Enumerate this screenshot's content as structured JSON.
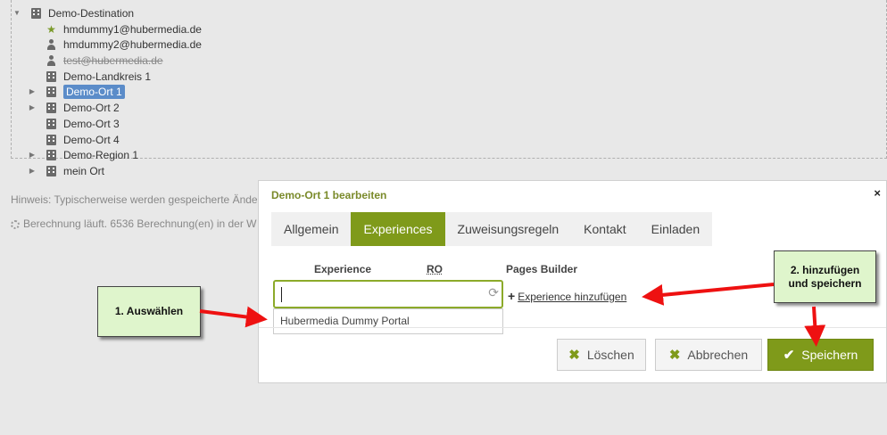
{
  "tree": [
    {
      "label": "Demo-Destination",
      "icon": "building-icon",
      "toggle": "▼",
      "selected": false,
      "strike": false
    },
    {
      "label": "hmdummy1@hubermedia.de",
      "icon": "star-icon",
      "toggle": "",
      "selected": false,
      "strike": false
    },
    {
      "label": "hmdummy2@hubermedia.de",
      "icon": "user-icon",
      "toggle": "",
      "selected": false,
      "strike": false
    },
    {
      "label": "test@hubermedia.de",
      "icon": "user-icon",
      "toggle": "",
      "selected": false,
      "strike": true
    },
    {
      "label": "Demo-Landkreis 1",
      "icon": "building-icon",
      "toggle": "",
      "selected": false,
      "strike": false
    },
    {
      "label": "Demo-Ort 1",
      "icon": "building-icon",
      "toggle": "▶",
      "selected": true,
      "strike": false
    },
    {
      "label": "Demo-Ort 2",
      "icon": "building-icon",
      "toggle": "▶",
      "selected": false,
      "strike": false
    },
    {
      "label": "Demo-Ort 3",
      "icon": "building-icon",
      "toggle": "",
      "selected": false,
      "strike": false
    },
    {
      "label": "Demo-Ort 4",
      "icon": "building-icon",
      "toggle": "",
      "selected": false,
      "strike": false
    },
    {
      "label": "Demo-Region 1",
      "icon": "building-icon",
      "toggle": "▶",
      "selected": false,
      "strike": false
    },
    {
      "label": "mein Ort",
      "icon": "building-icon",
      "toggle": "▶",
      "selected": false,
      "strike": false
    }
  ],
  "background": {
    "hint": "Hinweis: Typischerweise werden gespeicherte Ände",
    "calc": "Berechnung läuft. 6536 Berechnung(en) in der W"
  },
  "dialog": {
    "title": "Demo-Ort 1 bearbeiten",
    "close": "×",
    "tabs": [
      {
        "label": "Allgemein",
        "active": false
      },
      {
        "label": "Experiences",
        "active": true
      },
      {
        "label": "Zuweisungsregeln",
        "active": false
      },
      {
        "label": "Kontakt",
        "active": false
      },
      {
        "label": "Einladen",
        "active": false
      }
    ],
    "columns": {
      "experience": "Experience",
      "ro": "RO",
      "pages_builder": "Pages Builder"
    },
    "experience_input": {
      "value": "",
      "refresh_icon": "refresh-icon"
    },
    "dropdown_option": "Hubermedia Dummy Portal",
    "add_link": "Experience hinzufügen",
    "buttons": {
      "delete": "Löschen",
      "cancel": "Abbrechen",
      "save": "Speichern"
    }
  },
  "annotations": {
    "step1": "1. Auswählen",
    "step2_line1": "2. hinzufügen",
    "step2_line2": "und speichern"
  },
  "colors": {
    "accent": "#7f9a1a",
    "callout_bg": "#dff5cc",
    "arrow": "#ee1111",
    "selection": "#5b8cc9"
  }
}
